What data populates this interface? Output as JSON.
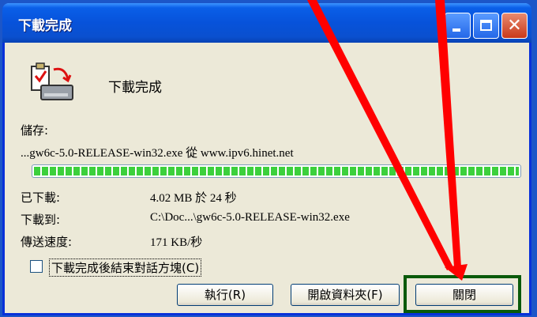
{
  "window": {
    "title": "下載完成"
  },
  "header": {
    "status_text": "下載完成",
    "icon": "download-complete-icon"
  },
  "file": {
    "save_label": "儲存:",
    "source_line": "...gw6c-5.0-RELEASE-win32.exe 從 www.ipv6.hinet.net",
    "progress_percent": 100
  },
  "details": [
    {
      "label": "已下載:",
      "value": "4.02 MB 於 24 秒"
    },
    {
      "label": "下載到:",
      "value": "C:\\Doc...\\gw6c-5.0-RELEASE-win32.exe"
    },
    {
      "label": "傳送速度:",
      "value": "171 KB/秒"
    }
  ],
  "option": {
    "close_after_label": "下載完成後結束對話方塊(C)",
    "checked": false
  },
  "buttons": {
    "run": "執行(R)",
    "open_folder": "開啟資料夾(F)",
    "close": "關閉"
  },
  "annotation": {
    "arrow_color": "#ff0000",
    "highlight_color": "#0a5a0a"
  }
}
